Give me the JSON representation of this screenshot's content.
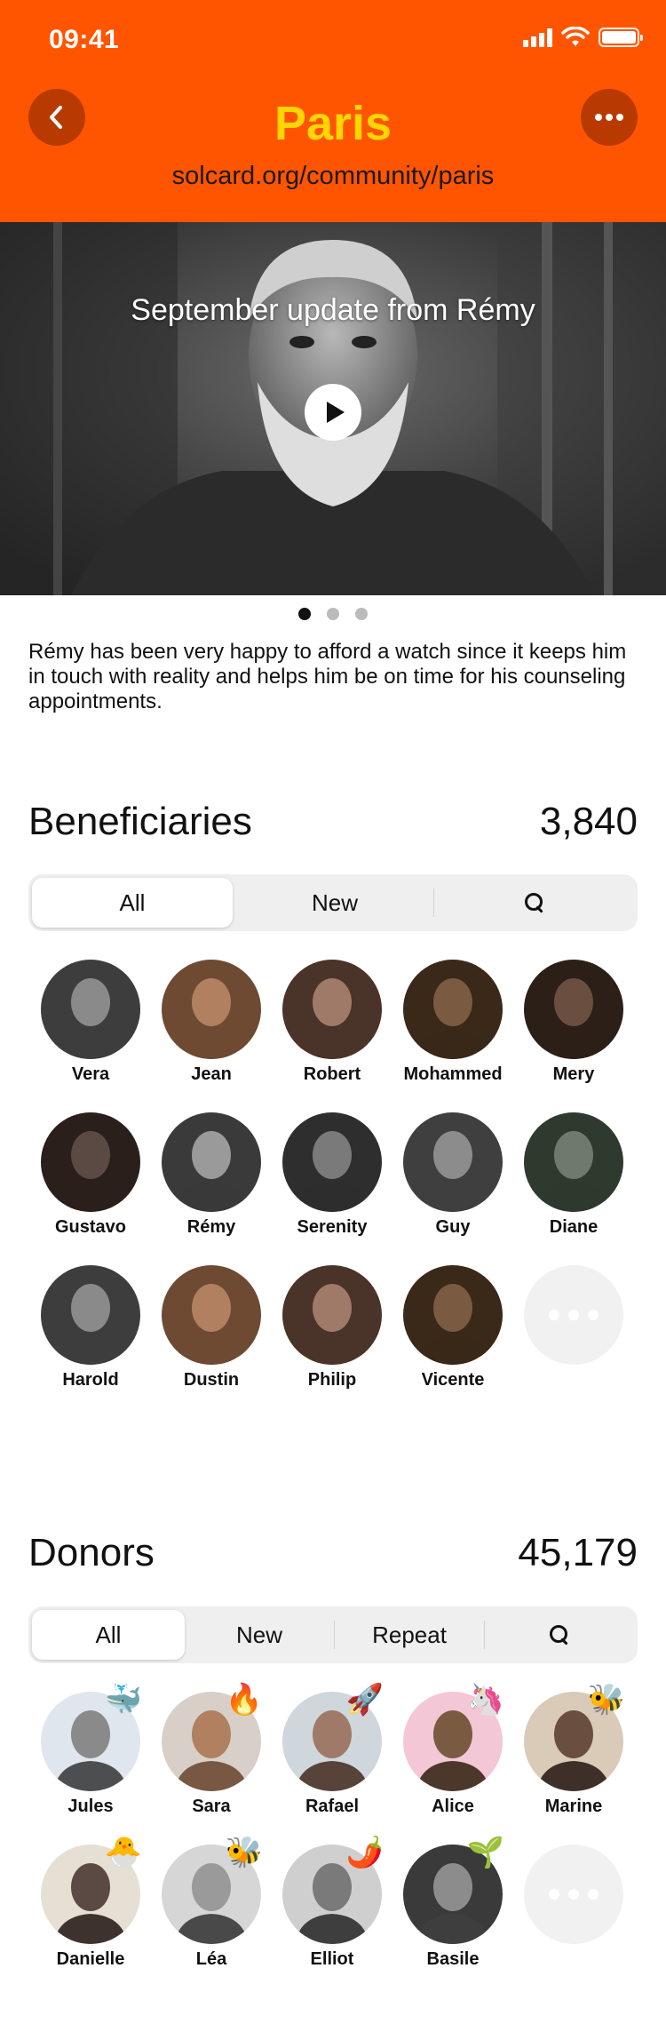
{
  "status_bar": {
    "time": "09:41"
  },
  "header": {
    "title": "Paris",
    "url": "solcard.org/community/paris"
  },
  "hero": {
    "caption": "September update from Rémy"
  },
  "story": {
    "text": "Rémy has been very happy to afford a watch since it keeps him in touch with reality and helps him be on time for his counseling appointments."
  },
  "beneficiaries": {
    "title": "Beneficiaries",
    "count": "3,840",
    "tabs": [
      {
        "label": "All"
      },
      {
        "label": "New"
      }
    ],
    "people": [
      {
        "name": "Vera"
      },
      {
        "name": "Jean"
      },
      {
        "name": "Robert"
      },
      {
        "name": "Mohammed"
      },
      {
        "name": "Mery"
      },
      {
        "name": "Gustavo"
      },
      {
        "name": "Rémy"
      },
      {
        "name": "Serenity"
      },
      {
        "name": "Guy"
      },
      {
        "name": "Diane"
      },
      {
        "name": "Harold"
      },
      {
        "name": "Dustin"
      },
      {
        "name": "Philip"
      },
      {
        "name": "Vicente"
      }
    ]
  },
  "donors": {
    "title": "Donors",
    "count": "45,179",
    "tabs": [
      {
        "label": "All"
      },
      {
        "label": "New"
      },
      {
        "label": "Repeat"
      }
    ],
    "people": [
      {
        "name": "Jules",
        "badge": "🐳"
      },
      {
        "name": "Sara",
        "badge": "🔥"
      },
      {
        "name": "Rafael",
        "badge": "🚀"
      },
      {
        "name": "Alice",
        "badge": "🦄"
      },
      {
        "name": "Marine",
        "badge": "🐝"
      },
      {
        "name": "Danielle",
        "badge": "🐣"
      },
      {
        "name": "Léa",
        "badge": "🐝"
      },
      {
        "name": "Elliot",
        "badge": "🌶️"
      },
      {
        "name": "Basile",
        "badge": "🌱"
      }
    ]
  },
  "colors": {
    "header_bg": "#FF5500",
    "title": "#FFD600",
    "button_bg": "#B83A00"
  },
  "icons": {
    "back": "chevron-left-icon",
    "more": "more-horizontal-icon",
    "play": "play-icon",
    "search": "search-icon"
  }
}
